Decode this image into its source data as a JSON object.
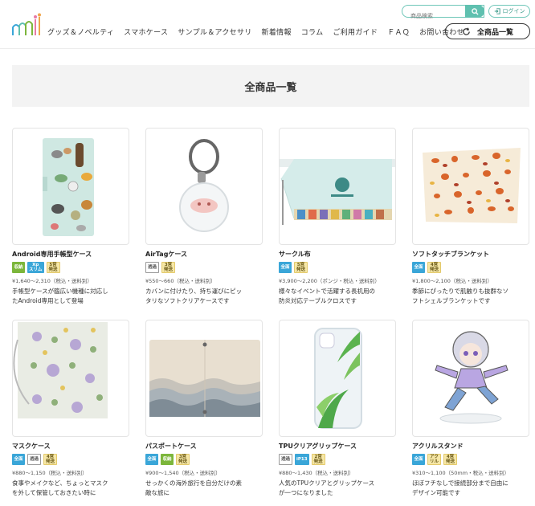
{
  "header": {
    "search_placeholder": "商品検索",
    "login_label": "ログイン",
    "nav": [
      "グッズ＆ノベルティ",
      "スマホケース",
      "サンプル＆アクセサリ",
      "新着情報",
      "コラム",
      "ご利用ガイド",
      "ＦＡＱ",
      "お問い合わせ"
    ],
    "all_products_label": "全商品一覧"
  },
  "page_title": "全商品一覧",
  "products": [
    {
      "name": "Android専用手帳型ケース",
      "badges": [
        {
          "t": "収納",
          "c": "green"
        },
        {
          "t": "Xp\nスリム",
          "c": "blue"
        },
        {
          "t": "5営\n発送",
          "c": "yellow"
        }
      ],
      "price": "¥1,640〜2,310（税込・送料別）",
      "desc": [
        "手帳型ケースが臨広い機種に対応し",
        "たAndroid専用として登場"
      ]
    },
    {
      "name": "AirTagケース",
      "badges": [
        {
          "t": "透過",
          "c": "gray"
        },
        {
          "t": "3営\n発送",
          "c": "yellow"
        }
      ],
      "price": "¥550〜660（税込・送料別）",
      "desc": [
        "カバンに付けたり、持ち運びにピッ",
        "タリなソフトクリアケースです"
      ]
    },
    {
      "name": "サークル布",
      "badges": [
        {
          "t": "全面",
          "c": "blue"
        },
        {
          "t": "5営\n発送",
          "c": "yellow"
        }
      ],
      "price": "¥3,900〜2,200（ポンジ・税込・送料別）",
      "desc": [
        "様々なイベントで活躍する長机用の",
        "防炎対応テーブルクロスです"
      ]
    },
    {
      "name": "ソフトタッチブランケット",
      "badges": [
        {
          "t": "全面",
          "c": "blue"
        },
        {
          "t": "4営\n発送",
          "c": "yellow"
        }
      ],
      "price": "¥1,800〜2,100（税込・送料別）",
      "desc": [
        "季節にぴったりで肌触りも抜群なソ",
        "フトシェルブランケットです"
      ]
    },
    {
      "name": "マスクケース",
      "badges": [
        {
          "t": "全面",
          "c": "blue"
        },
        {
          "t": "透過",
          "c": "gray"
        },
        {
          "t": "4営\n発送",
          "c": "yellow"
        }
      ],
      "price": "¥880〜1,150（税込・送料別）",
      "desc": [
        "食事やメイクなど、ちょっとマスク",
        "を外して保管しておきたい時に"
      ]
    },
    {
      "name": "パスポートケース",
      "badges": [
        {
          "t": "全面",
          "c": "blue"
        },
        {
          "t": "収納",
          "c": "green"
        },
        {
          "t": "3営\n発送",
          "c": "yellow"
        }
      ],
      "price": "¥900〜1,540（税込・送料別）",
      "desc": [
        "せっかくの海外旅行を自分だけの素",
        "敵な旅に"
      ]
    },
    {
      "name": "TPUクリアグリップケース",
      "badges": [
        {
          "t": "透過",
          "c": "gray"
        },
        {
          "t": "iP13",
          "c": "blue"
        },
        {
          "t": "2営\n発送",
          "c": "yellow"
        }
      ],
      "price": "¥880〜1,430（税込・送料別）",
      "desc": [
        "人気のTPUクリアとグリップケース",
        "が一つになりました"
      ]
    },
    {
      "name": "アクリルスタンド",
      "badges": [
        {
          "t": "全面",
          "c": "blue"
        },
        {
          "t": "アク\nリル",
          "c": "yellow"
        },
        {
          "t": "4営\n発送",
          "c": "yellow"
        }
      ],
      "price": "¥310〜1,100（50mm・税込・送料別）",
      "desc": [
        "ほぼフチなしで接続部分まで自由に",
        "デザイン可能です"
      ]
    }
  ],
  "colors": {
    "accent": "#5fc0af",
    "badge_blue": "#3aa6d8",
    "badge_green": "#7cb63b",
    "badge_yellow": "#f6e7a6"
  }
}
